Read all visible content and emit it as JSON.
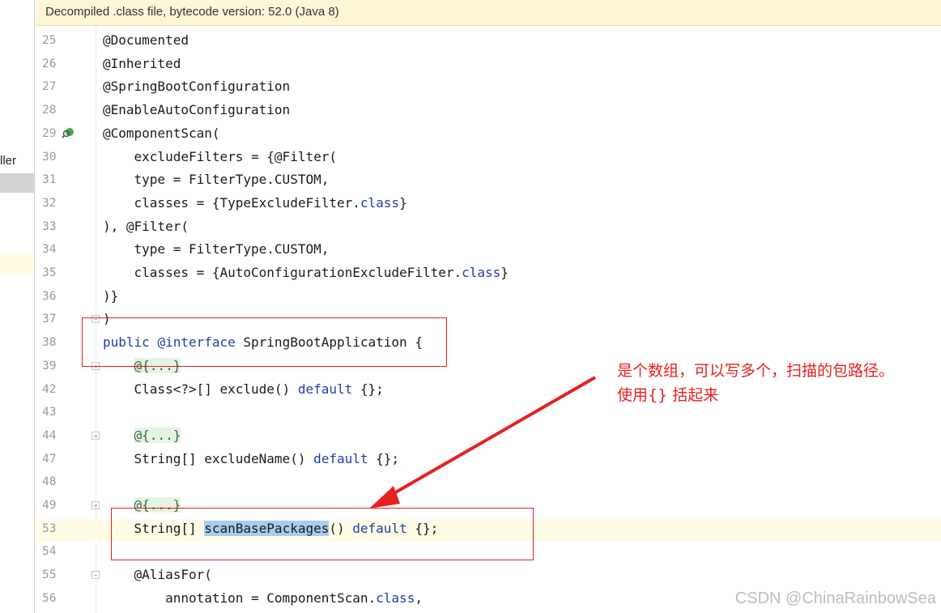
{
  "banner": {
    "text": "Decompiled .class file, bytecode version: 52.0 (Java 8)"
  },
  "left_panel": {
    "label": "ller"
  },
  "lines": [
    {
      "num": "25",
      "segs": [
        {
          "t": "@Documented",
          "c": "plain"
        }
      ]
    },
    {
      "num": "26",
      "segs": [
        {
          "t": "@Inherited",
          "c": "plain"
        }
      ]
    },
    {
      "num": "27",
      "segs": [
        {
          "t": "@SpringBootConfiguration",
          "c": "plain"
        }
      ]
    },
    {
      "num": "28",
      "segs": [
        {
          "t": "@EnableAutoConfiguration",
          "c": "plain"
        }
      ]
    },
    {
      "num": "29",
      "segs": [
        {
          "t": "@ComponentScan(",
          "c": "plain"
        }
      ],
      "gutter_icon": "search-bean-icon"
    },
    {
      "num": "30",
      "segs": [
        {
          "t": "    excludeFilters = {@Filter(",
          "c": "plain"
        }
      ]
    },
    {
      "num": "31",
      "segs": [
        {
          "t": "    type = FilterType.CUSTOM,",
          "c": "plain"
        }
      ]
    },
    {
      "num": "32",
      "segs": [
        {
          "t": "    classes = {TypeExcludeFilter.",
          "c": "plain"
        },
        {
          "t": "class",
          "c": "kw"
        },
        {
          "t": "}",
          "c": "plain"
        }
      ]
    },
    {
      "num": "33",
      "segs": [
        {
          "t": "), @Filter(",
          "c": "plain"
        }
      ]
    },
    {
      "num": "34",
      "segs": [
        {
          "t": "    type = FilterType.CUSTOM,",
          "c": "plain"
        }
      ]
    },
    {
      "num": "35",
      "segs": [
        {
          "t": "    classes = {AutoConfigurationExcludeFilter.",
          "c": "plain"
        },
        {
          "t": "class",
          "c": "kw"
        },
        {
          "t": "}",
          "c": "plain"
        }
      ]
    },
    {
      "num": "36",
      "segs": [
        {
          "t": ")}",
          "c": "plain"
        }
      ]
    },
    {
      "num": "37",
      "segs": [
        {
          "t": ")",
          "c": "plain"
        }
      ]
    },
    {
      "num": "38",
      "segs": [
        {
          "t": "public",
          "c": "kw"
        },
        {
          "t": " ",
          "c": "plain"
        },
        {
          "t": "@interface",
          "c": "kw"
        },
        {
          "t": " SpringBootApplication {",
          "c": "plain"
        }
      ]
    },
    {
      "num": "39",
      "segs": [
        {
          "t": "    ",
          "c": "plain"
        },
        {
          "t": "@{...}",
          "c": "fold"
        }
      ]
    },
    {
      "num": "42",
      "segs": [
        {
          "t": "    Class<?>[] exclude() ",
          "c": "plain"
        },
        {
          "t": "default",
          "c": "kw"
        },
        {
          "t": " {};",
          "c": "plain"
        }
      ]
    },
    {
      "num": "43",
      "segs": []
    },
    {
      "num": "44",
      "segs": [
        {
          "t": "    ",
          "c": "plain"
        },
        {
          "t": "@{...}",
          "c": "fold"
        }
      ]
    },
    {
      "num": "47",
      "segs": [
        {
          "t": "    String[] excludeName() ",
          "c": "plain"
        },
        {
          "t": "default",
          "c": "kw"
        },
        {
          "t": " {};",
          "c": "plain"
        }
      ]
    },
    {
      "num": "48",
      "segs": []
    },
    {
      "num": "49",
      "segs": [
        {
          "t": "    ",
          "c": "plain"
        },
        {
          "t": "@{...}",
          "c": "fold"
        }
      ]
    },
    {
      "num": "53",
      "segs": [
        {
          "t": "    String[] ",
          "c": "plain"
        },
        {
          "t": "scanBasePackages",
          "c": "sel"
        },
        {
          "t": "() ",
          "c": "plain"
        },
        {
          "t": "default",
          "c": "kw"
        },
        {
          "t": " {};",
          "c": "plain"
        }
      ]
    },
    {
      "num": "54",
      "segs": []
    },
    {
      "num": "55",
      "segs": [
        {
          "t": "    @AliasFor(",
          "c": "plain"
        }
      ]
    },
    {
      "num": "56",
      "segs": [
        {
          "t": "        annotation = ComponentScan.",
          "c": "plain"
        },
        {
          "t": "class",
          "c": "kw"
        },
        {
          "t": ",",
          "c": "plain"
        }
      ]
    }
  ],
  "annotation": {
    "line1": "是个数组，可以写多个，扫描的包路径。",
    "line2": "使用{} 括起来"
  },
  "watermark": "CSDN @ChinaRainbowSea",
  "colors": {
    "keyword": "#1e3fa8",
    "annotation": "#e8201f",
    "banner_bg": "#fdf7d8",
    "selection": "#a8cdf0"
  }
}
